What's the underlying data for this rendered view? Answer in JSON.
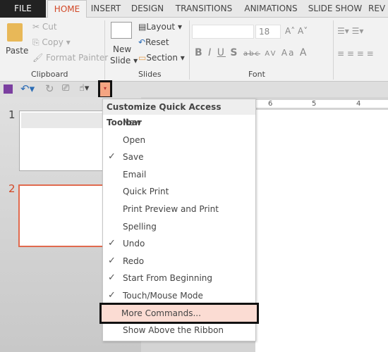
{
  "tabs": [
    "FILE",
    "HOME",
    "INSERT",
    "DESIGN",
    "TRANSITIONS",
    "ANIMATIONS",
    "SLIDE SHOW",
    "REV"
  ],
  "active_tab": "HOME",
  "ribbon": {
    "clipboard": {
      "label": "Clipboard",
      "paste": "Paste",
      "cut": "Cut",
      "copy": "Copy",
      "format_painter": "Format Painter"
    },
    "slides": {
      "label": "Slides",
      "new_slide_1": "New",
      "new_slide_2": "Slide",
      "layout": "Layout",
      "reset": "Reset",
      "section": "Section"
    },
    "font": {
      "label": "Font",
      "font_size": "18",
      "bold": "B",
      "italic": "I",
      "underline": "U",
      "shadow": "S",
      "strike": "abc",
      "spacing": "AV",
      "case": "Aa",
      "color": "A"
    }
  },
  "ruler": [
    "6",
    "5",
    "4"
  ],
  "slides": [
    "1",
    "2"
  ],
  "menu": {
    "title": "Customize Quick Access Toolbar",
    "items": [
      {
        "label": "New",
        "checked": false
      },
      {
        "label": "Open",
        "checked": false
      },
      {
        "label": "Save",
        "checked": true
      },
      {
        "label": "Email",
        "checked": false
      },
      {
        "label": "Quick Print",
        "checked": false
      },
      {
        "label": "Print Preview and Print",
        "checked": false
      },
      {
        "label": "Spelling",
        "checked": false
      },
      {
        "label": "Undo",
        "checked": true
      },
      {
        "label": "Redo",
        "checked": true
      },
      {
        "label": "Start From Beginning",
        "checked": true
      },
      {
        "label": "Touch/Mouse Mode",
        "checked": true
      },
      {
        "label": "More Commands...",
        "checked": false,
        "highlighted": true
      },
      {
        "label": "Show Above the Ribbon",
        "checked": false
      }
    ]
  },
  "colors": {
    "accent": "#d24726",
    "highlight": "#fbdcd3",
    "qat_button": "#f4a582"
  }
}
